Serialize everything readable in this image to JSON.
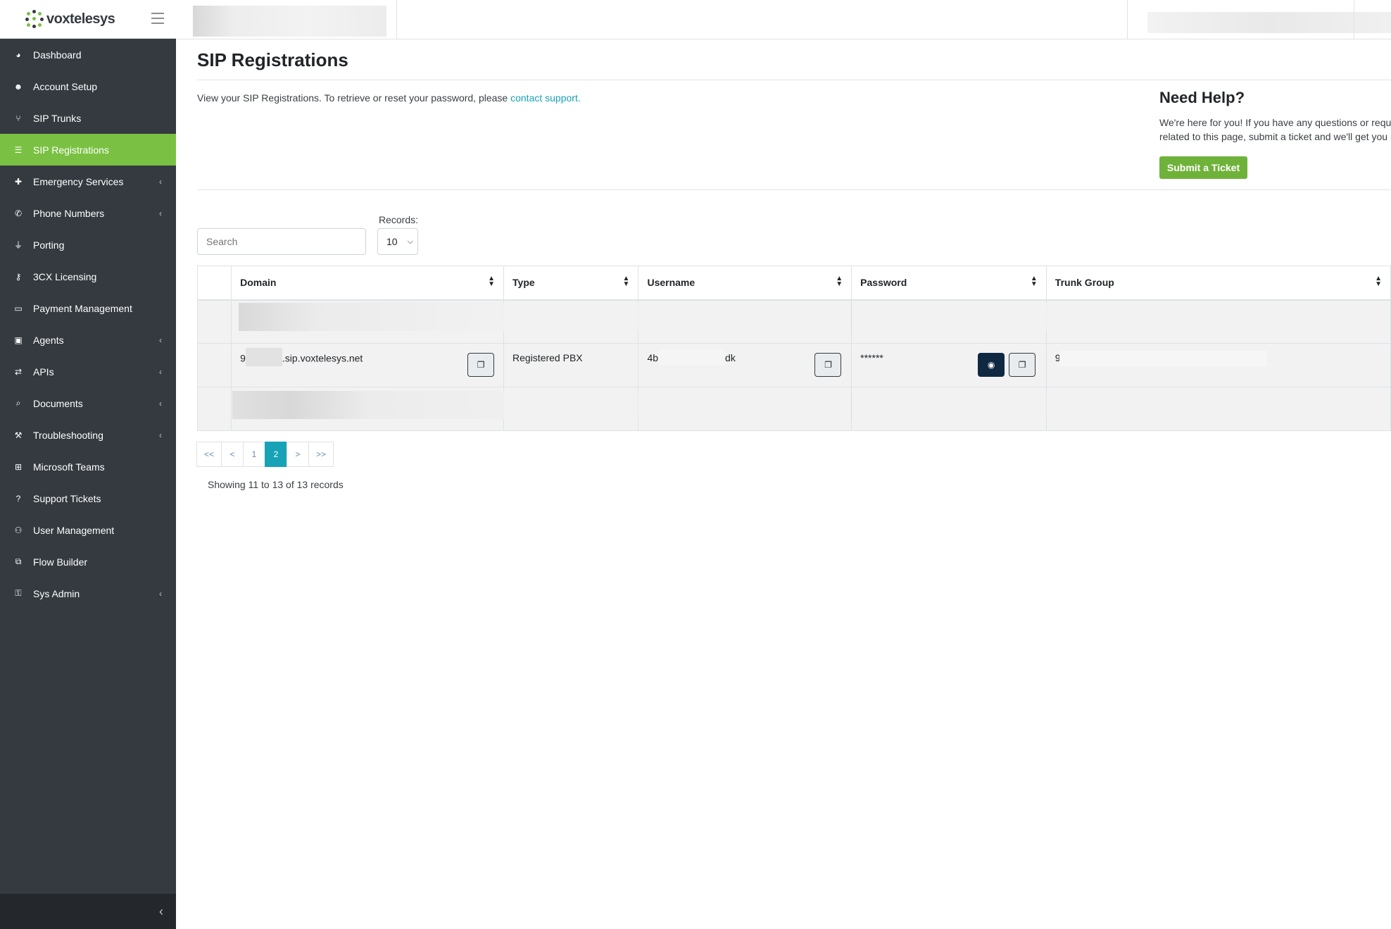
{
  "brand": {
    "name_part1": "vox",
    "name_part2": "telesys"
  },
  "sidebar": {
    "items": [
      {
        "label": "Dashboard",
        "icon": "dashboard-icon",
        "active": false,
        "has_caret": false
      },
      {
        "label": "Account Setup",
        "icon": "user-circle-icon",
        "active": false,
        "has_caret": false
      },
      {
        "label": "SIP Trunks",
        "icon": "branch-icon",
        "active": false,
        "has_caret": false
      },
      {
        "label": "SIP Registrations",
        "icon": "list-icon",
        "active": true,
        "has_caret": false
      },
      {
        "label": "Emergency Services",
        "icon": "medkit-icon",
        "active": false,
        "has_caret": true
      },
      {
        "label": "Phone Numbers",
        "icon": "phone-icon",
        "active": false,
        "has_caret": true
      },
      {
        "label": "Porting",
        "icon": "plug-icon",
        "active": false,
        "has_caret": false
      },
      {
        "label": "3CX Licensing",
        "icon": "key-icon",
        "active": false,
        "has_caret": false
      },
      {
        "label": "Payment Management",
        "icon": "credit-card-icon",
        "active": false,
        "has_caret": false
      },
      {
        "label": "Agents",
        "icon": "briefcase-icon",
        "active": false,
        "has_caret": true
      },
      {
        "label": "APIs",
        "icon": "exchange-icon",
        "active": false,
        "has_caret": true
      },
      {
        "label": "Documents",
        "icon": "search-icon",
        "active": false,
        "has_caret": true
      },
      {
        "label": "Troubleshooting",
        "icon": "wrench-icon",
        "active": false,
        "has_caret": true
      },
      {
        "label": "Microsoft Teams",
        "icon": "windows-icon",
        "active": false,
        "has_caret": false
      },
      {
        "label": "Support Tickets",
        "icon": "question-icon",
        "active": false,
        "has_caret": false
      },
      {
        "label": "User Management",
        "icon": "users-icon",
        "active": false,
        "has_caret": false
      },
      {
        "label": "Flow Builder",
        "icon": "sitemap-icon",
        "active": false,
        "has_caret": false
      },
      {
        "label": "Sys Admin",
        "icon": "lock-icon",
        "active": false,
        "has_caret": true
      }
    ],
    "caret_glyph": "‹",
    "collapse_glyph": "‹"
  },
  "page": {
    "title": "SIP Registrations",
    "intro_text": "View your SIP Registrations. To retrieve or reset your password, please ",
    "intro_link": "contact support."
  },
  "help": {
    "title": "Need Help?",
    "line1": "We're here for you! If you have any questions or requi",
    "line2": "related to this page, submit a ticket and we'll get you i",
    "button": "Submit a Ticket"
  },
  "filters": {
    "search_placeholder": "Search",
    "records_label": "Records:",
    "records_value": "10"
  },
  "table": {
    "columns": [
      "",
      "Domain",
      "Type",
      "Username",
      "Password",
      "Trunk Group"
    ],
    "visible_row": {
      "domain_start": "9",
      "domain_end": ".sip.voxtelesys.net",
      "type": "Registered PBX",
      "username_start": "4b",
      "username_end": "dk",
      "password": "******",
      "trunk_group_start": "9"
    }
  },
  "pagination": {
    "buttons": [
      "<<",
      "<",
      "1",
      "2",
      ">",
      ">>"
    ],
    "active": "2",
    "showing": "Showing 11 to 13 of 13 records"
  },
  "colors": {
    "sidebar_bg": "#343a40",
    "active_green": "#7ac143",
    "link_teal": "#17a2b8",
    "dark_button": "#0f2942"
  }
}
